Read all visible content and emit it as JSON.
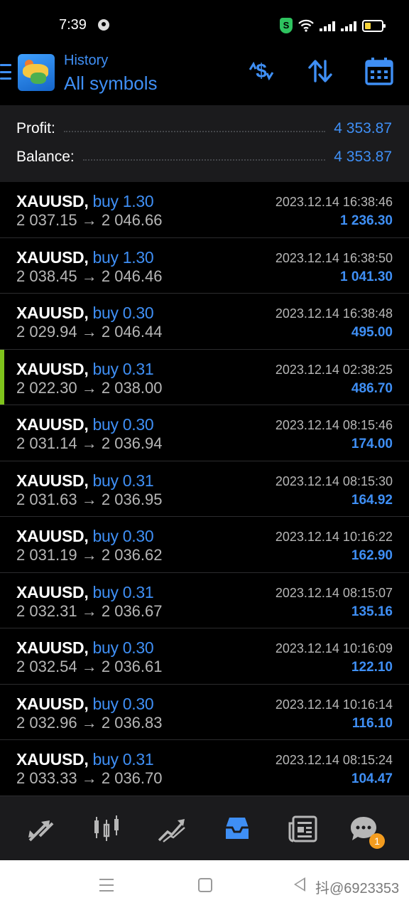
{
  "status_bar": {
    "time": "7:39",
    "icons": [
      "app-notification-icon",
      "shield-icon",
      "wifi-icon",
      "signal-icon",
      "signal-icon",
      "battery-icon"
    ],
    "shield_text": "S"
  },
  "header": {
    "subtitle": "History",
    "title": "All symbols",
    "actions": [
      "currency-exchange-icon",
      "sort-icon",
      "calendar-icon"
    ]
  },
  "summary": {
    "profit_label": "Profit:",
    "profit_value": "4 353.87",
    "balance_label": "Balance:",
    "balance_value": "4 353.87"
  },
  "deals": [
    {
      "symbol": "XAUUSD,",
      "side": "buy 1.30",
      "prices": "2 037.15 → 2 046.66",
      "time": "2023.12.14 16:38:46",
      "profit": "1 236.30"
    },
    {
      "symbol": "XAUUSD,",
      "side": "buy 1.30",
      "prices": "2 038.45 → 2 046.46",
      "time": "2023.12.14 16:38:50",
      "profit": "1 041.30"
    },
    {
      "symbol": "XAUUSD,",
      "side": "buy 0.30",
      "prices": "2 029.94 → 2 046.44",
      "time": "2023.12.14 16:38:48",
      "profit": "495.00"
    },
    {
      "symbol": "XAUUSD,",
      "side": "buy 0.31",
      "prices": "2 022.30 → 2 038.00",
      "time": "2023.12.14 02:38:25",
      "profit": "486.70",
      "selected": true
    },
    {
      "symbol": "XAUUSD,",
      "side": "buy 0.30",
      "prices": "2 031.14 → 2 036.94",
      "time": "2023.12.14 08:15:46",
      "profit": "174.00"
    },
    {
      "symbol": "XAUUSD,",
      "side": "buy 0.31",
      "prices": "2 031.63 → 2 036.95",
      "time": "2023.12.14 08:15:30",
      "profit": "164.92"
    },
    {
      "symbol": "XAUUSD,",
      "side": "buy 0.30",
      "prices": "2 031.19 → 2 036.62",
      "time": "2023.12.14 10:16:22",
      "profit": "162.90"
    },
    {
      "symbol": "XAUUSD,",
      "side": "buy 0.31",
      "prices": "2 032.31 → 2 036.67",
      "time": "2023.12.14 08:15:07",
      "profit": "135.16"
    },
    {
      "symbol": "XAUUSD,",
      "side": "buy 0.30",
      "prices": "2 032.54 → 2 036.61",
      "time": "2023.12.14 10:16:09",
      "profit": "122.10"
    },
    {
      "symbol": "XAUUSD,",
      "side": "buy 0.30",
      "prices": "2 032.96 → 2 036.83",
      "time": "2023.12.14 10:16:14",
      "profit": "116.10"
    },
    {
      "symbol": "XAUUSD,",
      "side": "buy 0.31",
      "prices": "2 033.33 → 2 036.70",
      "time": "2023.12.14 08:15:24",
      "profit": "104.47"
    }
  ],
  "tab_bar": {
    "tabs": [
      "quotes-icon",
      "chart-icon",
      "trade-icon",
      "history-icon",
      "news-icon",
      "chat-icon"
    ],
    "active_tab": "history-icon",
    "chat_badge": "1"
  },
  "system_nav": {
    "watermark": "抖@6923353"
  },
  "colors": {
    "accent": "#3f8ff5",
    "background": "#000000",
    "panel": "#1b1b1d",
    "muted_text": "#b7b7b7",
    "selection_marker": "#7fc31c",
    "badge": "#f39c1f"
  }
}
